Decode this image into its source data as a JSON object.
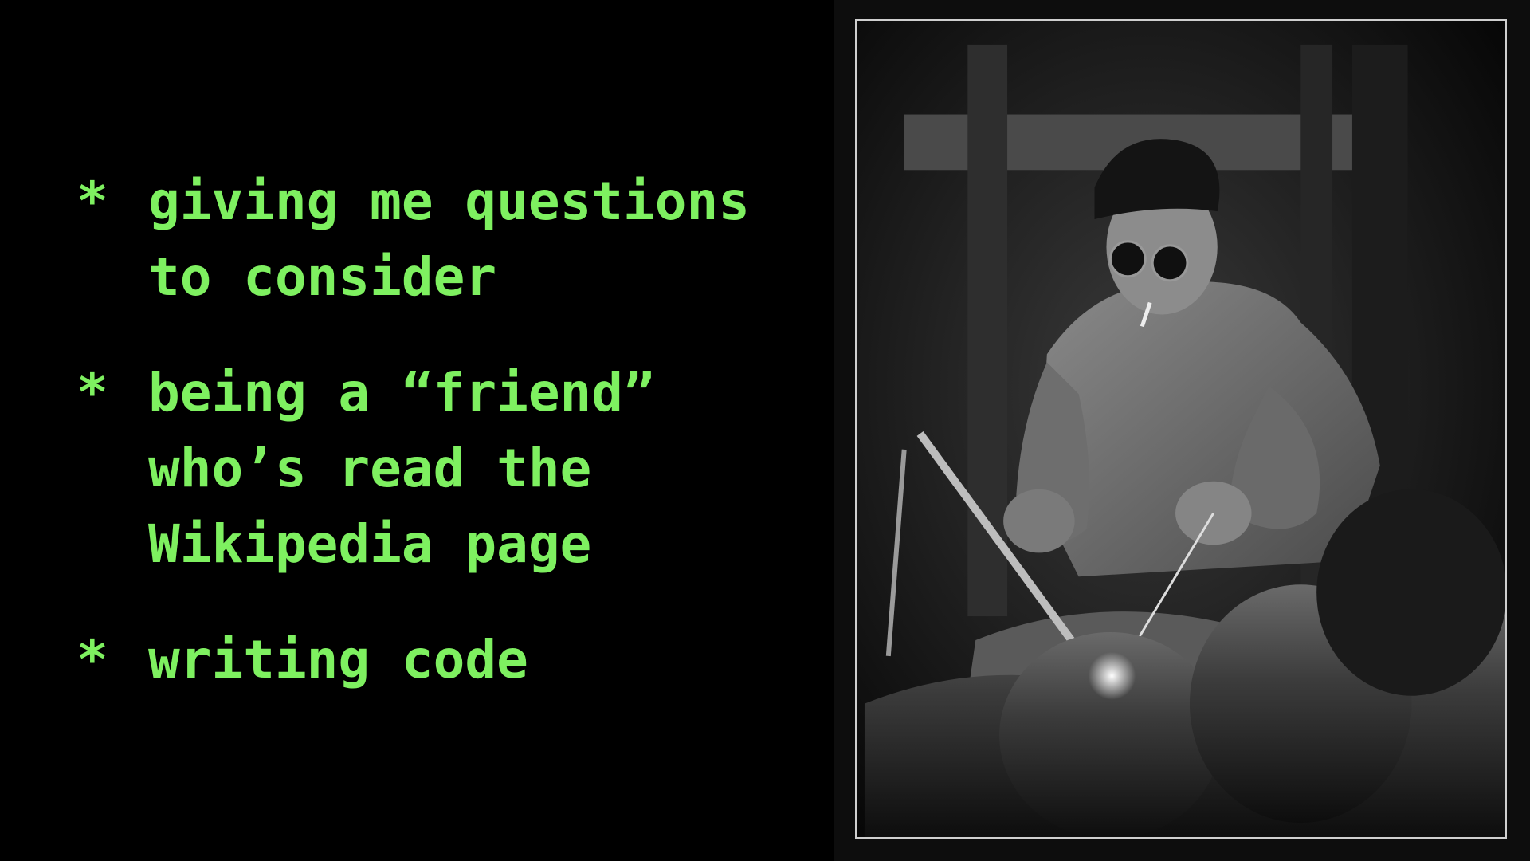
{
  "bullets": [
    {
      "marker": "*",
      "lines": [
        "giving me questions",
        "to consider"
      ]
    },
    {
      "marker": "*",
      "lines": [
        "being a “friend”",
        "who’s read the",
        "Wikipedia page"
      ]
    },
    {
      "marker": "*",
      "lines": [
        "writing code"
      ]
    }
  ],
  "colors": {
    "background": "#000000",
    "text": "#7ef060"
  },
  "photo": {
    "subject": "welder-photo",
    "style": "black-and-white"
  }
}
